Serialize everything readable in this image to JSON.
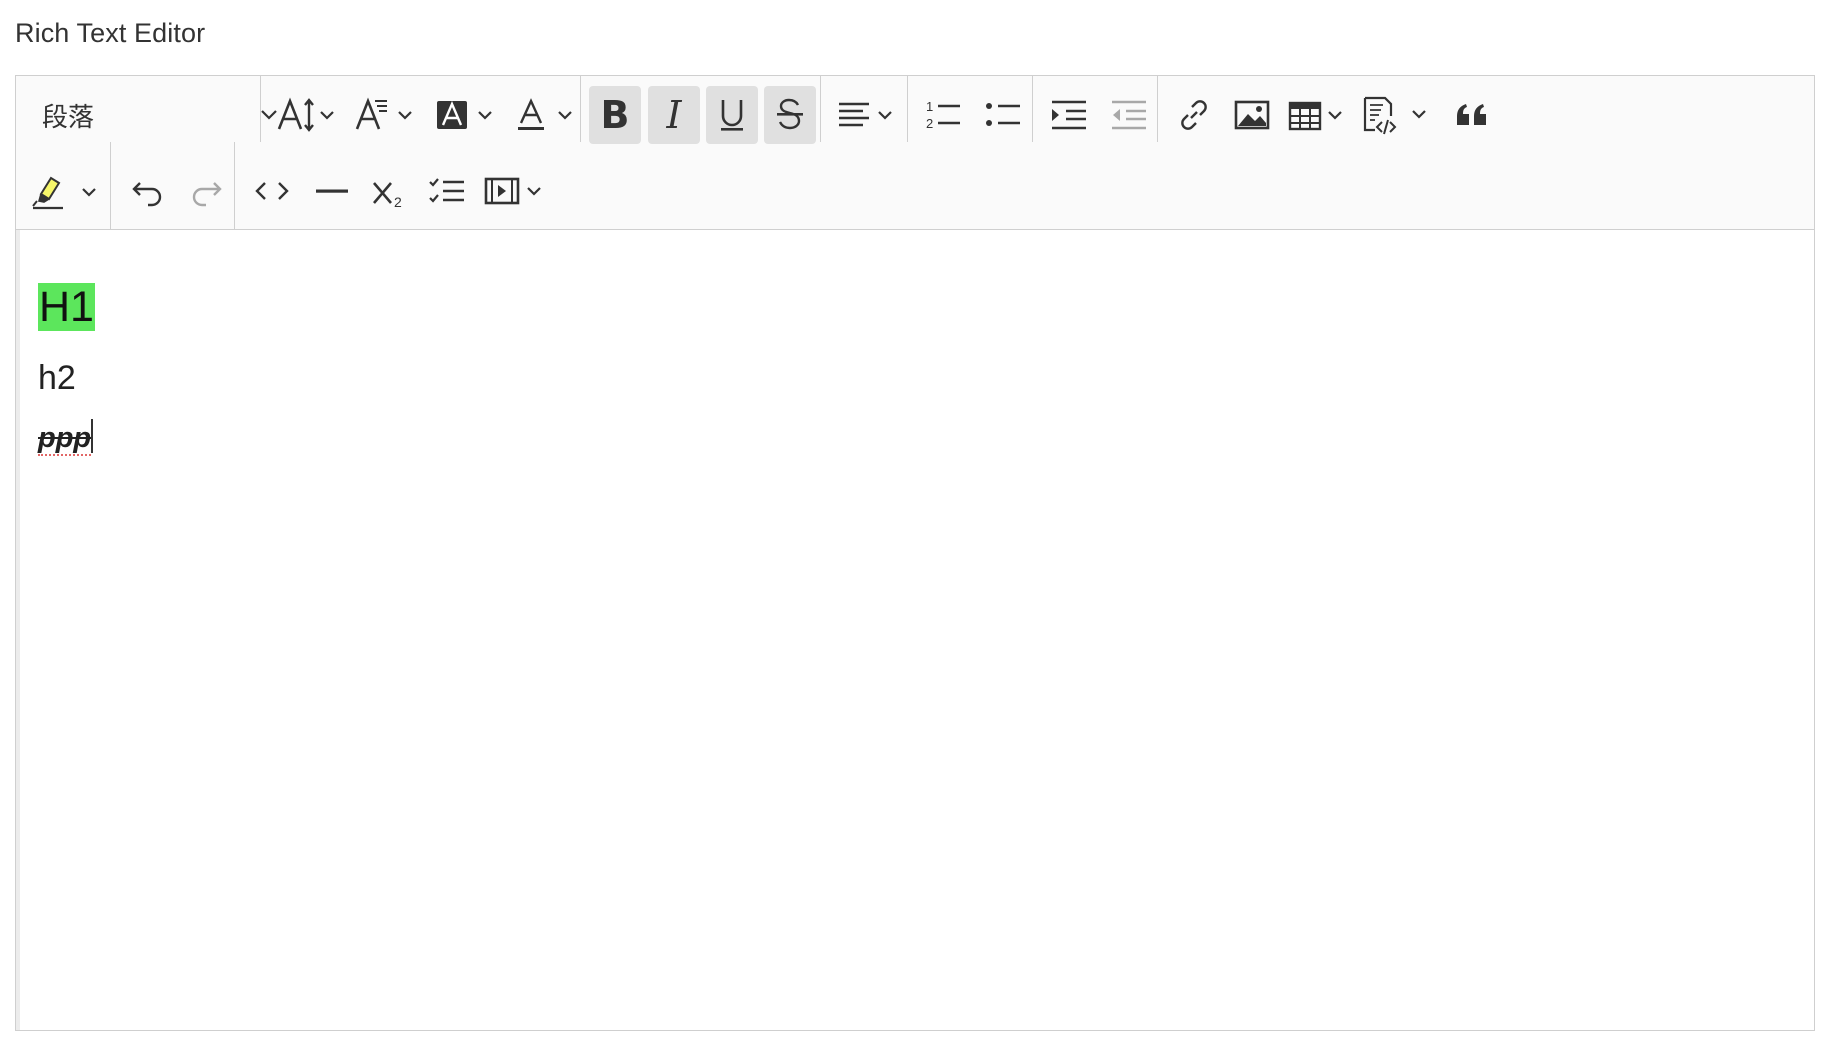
{
  "field_label": "Rich Text Editor",
  "toolbar": {
    "heading_value": "段落",
    "buttons": [
      {
        "name": "font-size-button",
        "icon": "font-size-icon"
      },
      {
        "name": "font-family-button",
        "icon": "font-family-icon"
      },
      {
        "name": "font-background-color-button",
        "icon": "font-background-color-icon"
      },
      {
        "name": "font-color-button",
        "icon": "font-color-icon"
      },
      {
        "name": "bold-button",
        "icon": "bold-icon",
        "active": true
      },
      {
        "name": "italic-button",
        "icon": "italic-icon",
        "active": true
      },
      {
        "name": "underline-button",
        "icon": "underline-icon",
        "active": true
      },
      {
        "name": "strikethrough-button",
        "icon": "strikethrough-icon",
        "active": true
      },
      {
        "name": "alignment-button",
        "icon": "align-left-icon"
      },
      {
        "name": "numbered-list-button",
        "icon": "numbered-list-icon"
      },
      {
        "name": "bulleted-list-button",
        "icon": "bulleted-list-icon"
      },
      {
        "name": "indent-button",
        "icon": "indent-icon"
      },
      {
        "name": "outdent-button",
        "icon": "outdent-icon",
        "disabled": true
      },
      {
        "name": "link-button",
        "icon": "link-icon"
      },
      {
        "name": "image-button",
        "icon": "image-icon"
      },
      {
        "name": "table-button",
        "icon": "table-icon"
      },
      {
        "name": "code-block-button",
        "icon": "code-block-icon"
      },
      {
        "name": "block-quote-button",
        "icon": "quote-icon"
      },
      {
        "name": "highlight-button",
        "icon": "highlight-marker-icon"
      },
      {
        "name": "undo-button",
        "icon": "undo-icon"
      },
      {
        "name": "redo-button",
        "icon": "redo-icon",
        "disabled": true
      },
      {
        "name": "source-editing-button",
        "icon": "source-code-icon"
      },
      {
        "name": "horizontal-line-button",
        "icon": "horizontal-line-icon"
      },
      {
        "name": "subscript-button",
        "icon": "subscript-icon"
      },
      {
        "name": "todo-list-button",
        "icon": "todo-list-icon"
      },
      {
        "name": "media-embed-button",
        "icon": "media-embed-icon"
      }
    ]
  },
  "content": {
    "h1": "H1",
    "h2": "h2",
    "paragraph": "ppp"
  },
  "colors": {
    "highlight": "#5ce65c",
    "active_button_bg": "#e0e0e0",
    "toolbar_bg": "#fafafa",
    "border": "#cfcfcf"
  }
}
